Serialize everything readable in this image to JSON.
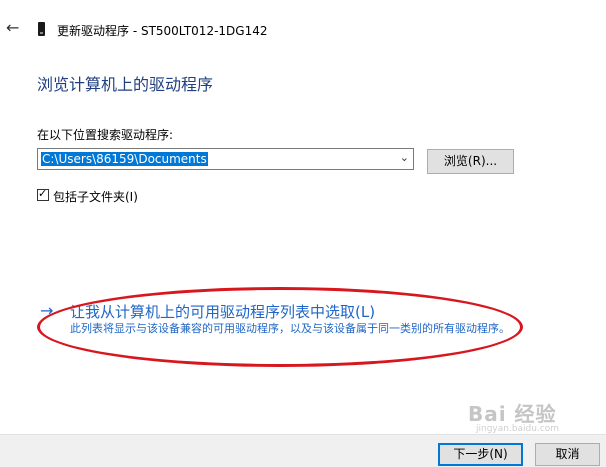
{
  "window": {
    "back_icon": "back-arrow-icon",
    "device_icon": "device-drive-icon",
    "title": "更新驱动程序 - ST500LT012-1DG142"
  },
  "page": {
    "heading": "浏览计算机上的驱动程序",
    "search_label": "在以下位置搜索驱动程序:",
    "path_value": "C:\\Users\\86159\\Documents",
    "browse_label": "浏览(R)...",
    "include_subfolders_label": "包括子文件夹(I)",
    "include_subfolders_checked": true
  },
  "pick_option": {
    "link_title": "让我从计算机上的可用驱动程序列表中选取(L)",
    "description": "此列表将显示与该设备兼容的可用驱动程序，以及与该设备属于同一类别的所有驱动程序。"
  },
  "footer": {
    "next_label": "下一步(N)",
    "cancel_label": "取消"
  },
  "watermark": {
    "text": "Bai 经验",
    "sub": "jingyan.baidu.com"
  },
  "colors": {
    "heading": "#1f3f80",
    "link": "#1f66c7",
    "selection": "#0078d7",
    "annotation": "#d8161e"
  }
}
